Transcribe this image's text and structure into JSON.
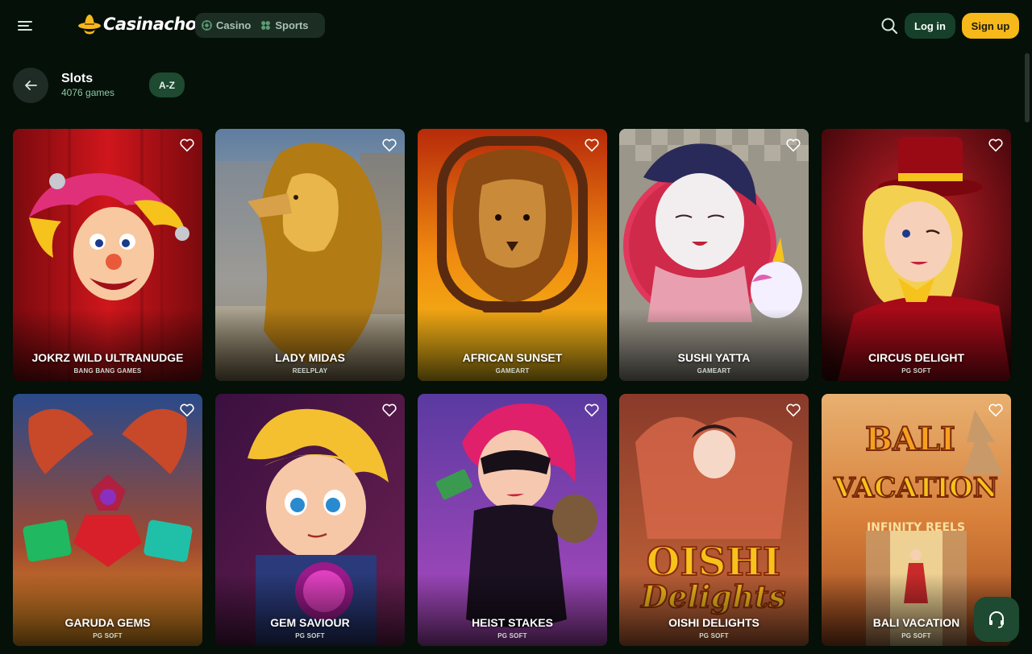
{
  "header": {
    "logo_text": "Casinacho",
    "nav": [
      {
        "label": "Casino",
        "icon": "casino-chip-icon"
      },
      {
        "label": "Sports",
        "icon": "sports-ball-icon"
      }
    ],
    "login_label": "Log in",
    "signup_label": "Sign up"
  },
  "section": {
    "title": "Slots",
    "count": "4076 games",
    "sort_label": "A-Z"
  },
  "games": [
    {
      "title": "JOKRZ WILD ULTRANUDGE",
      "provider": "BANG BANG GAMES",
      "art": "jester"
    },
    {
      "title": "LADY MIDAS",
      "provider": "REELPLAY",
      "art": "lion-gold"
    },
    {
      "title": "AFRICAN SUNSET",
      "provider": "GAMEART",
      "art": "lion-sunset"
    },
    {
      "title": "SUSHI YATTA",
      "provider": "GAMEART",
      "art": "geisha"
    },
    {
      "title": "CIRCUS DELIGHT",
      "provider": "PG SOFT",
      "art": "circus"
    },
    {
      "title": "GARUDA GEMS",
      "provider": "PG SOFT",
      "art": "gems"
    },
    {
      "title": "GEM SAVIOUR",
      "provider": "PG SOFT",
      "art": "hero"
    },
    {
      "title": "HEIST STAKES",
      "provider": "PG SOFT",
      "art": "heist"
    },
    {
      "title": "OISHI DELIGHTS",
      "provider": "PG SOFT",
      "art": "oishi"
    },
    {
      "title": "BALI VACATION",
      "provider": "PG SOFT",
      "art": "bali"
    }
  ],
  "art_text": {
    "oishi": "OISHI Delights",
    "bali": "BALI VACATION",
    "bali_sub": "INFINITY REELS"
  },
  "colors": {
    "background": "#041008",
    "accent_green": "#1d4a31",
    "signup_yellow": "#f7b81a"
  }
}
